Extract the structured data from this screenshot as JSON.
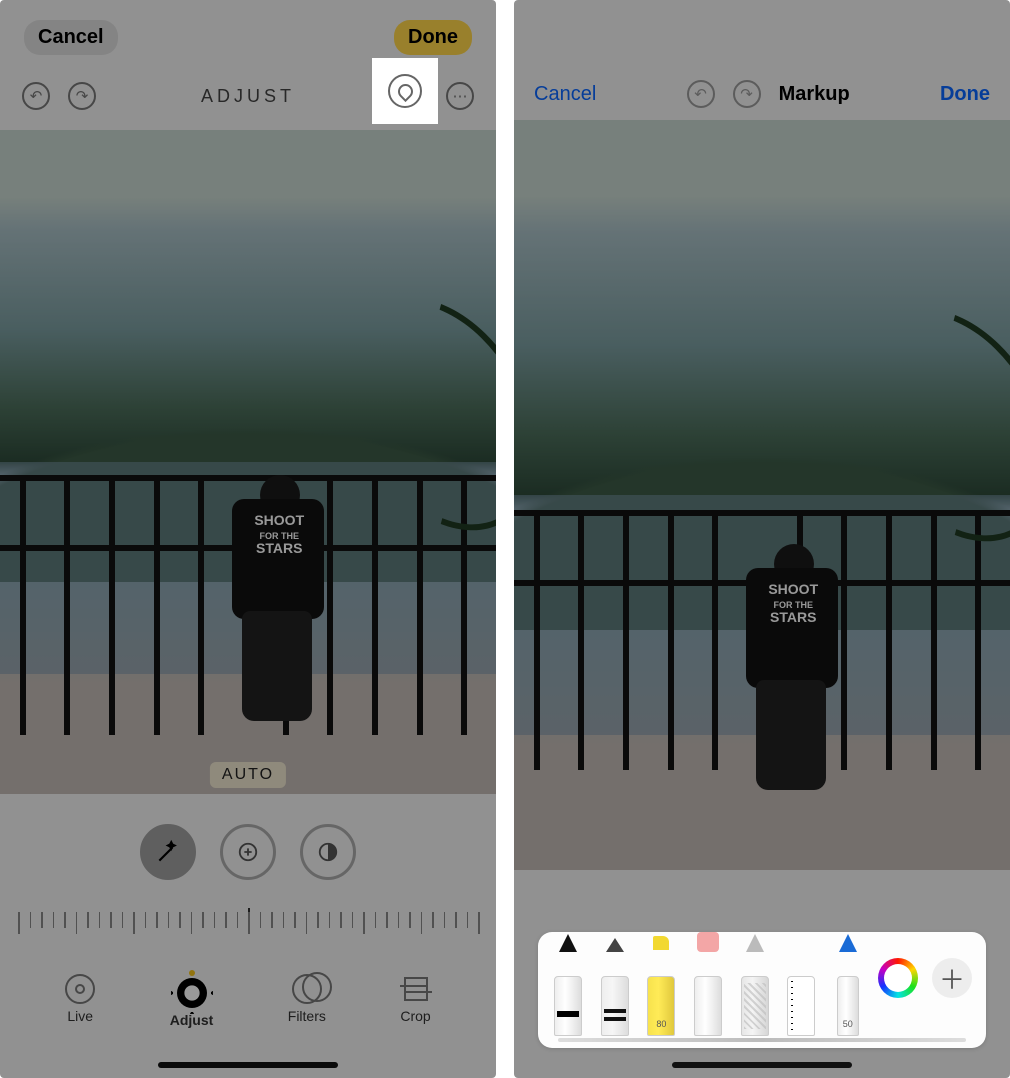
{
  "left": {
    "cancel": "Cancel",
    "done": "Done",
    "screen_title": "ADJUST",
    "auto_chip": "AUTO",
    "tabs": [
      {
        "key": "live",
        "label": "Live",
        "icon": "live-icon"
      },
      {
        "key": "adjust",
        "label": "Adjust",
        "icon": "adjust-dial-icon"
      },
      {
        "key": "filters",
        "label": "Filters",
        "icon": "filters-icon"
      },
      {
        "key": "crop",
        "label": "Crop",
        "icon": "crop-icon"
      }
    ],
    "tools": [
      {
        "key": "wand",
        "icon": "magic-wand-icon"
      },
      {
        "key": "exposure",
        "icon": "exposure-icon"
      },
      {
        "key": "contrast",
        "icon": "contrast-icon"
      }
    ],
    "toolbar_icons": {
      "undo": "undo-icon",
      "redo": "redo-icon",
      "markup": "markup-pen-icon",
      "more": "ellipsis-circle-icon"
    },
    "active_tab": "adjust",
    "selected_tool": "wand",
    "photo_overlay": {
      "garment_text_1": "SHOOT",
      "garment_text_2": "FOR THE",
      "garment_text_3": "STARS"
    }
  },
  "right": {
    "cancel": "Cancel",
    "title": "Markup",
    "done": "Done",
    "toolbar_icons": {
      "undo": "undo-icon",
      "redo": "redo-icon"
    },
    "tools": [
      {
        "key": "pen",
        "icon": "pen-tool-icon",
        "label": ""
      },
      {
        "key": "marker",
        "icon": "marker-tool-icon",
        "label": ""
      },
      {
        "key": "hiliter",
        "icon": "highlighter-tool-icon",
        "label": "80"
      },
      {
        "key": "eraser",
        "icon": "eraser-tool-icon",
        "label": ""
      },
      {
        "key": "lasso",
        "icon": "lasso-tool-icon",
        "label": ""
      },
      {
        "key": "ruler",
        "icon": "ruler-tool-icon",
        "label": ""
      },
      {
        "key": "pencil",
        "icon": "pencil-tool-icon",
        "label": "50"
      }
    ],
    "color": "#000000",
    "add_icon": "plus-icon",
    "photo_overlay": {
      "garment_text_1": "SHOOT",
      "garment_text_2": "FOR THE",
      "garment_text_3": "STARS"
    }
  },
  "colors": {
    "accent_yellow": "#ffd54a",
    "ios_blue": "#0a66ff"
  }
}
